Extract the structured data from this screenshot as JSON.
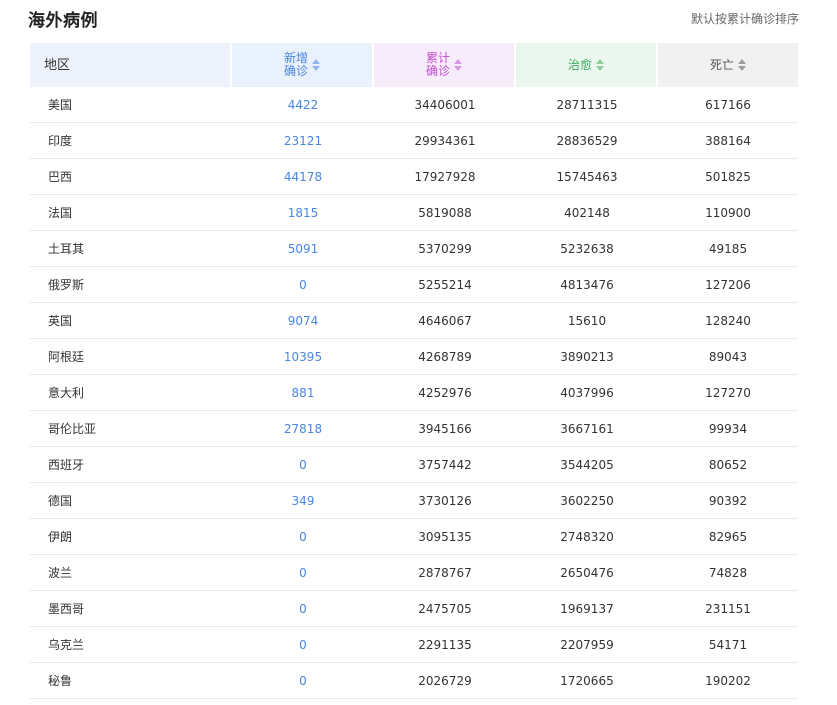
{
  "page": {
    "title": "海外病例",
    "sort_hint": "默认按累计确诊排序"
  },
  "columns": {
    "region": "地区",
    "new": "新增\n确诊",
    "total": "累计\n确诊",
    "cured": "治愈",
    "dead": "死亡"
  },
  "colors": {
    "new": "#4a86e0",
    "total": "#c24fd3",
    "cured": "#3aaa5e",
    "dead": "#555555"
  },
  "rows": [
    {
      "region": "美国",
      "new": "4422",
      "total": "34406001",
      "cured": "28711315",
      "dead": "617166"
    },
    {
      "region": "印度",
      "new": "23121",
      "total": "29934361",
      "cured": "28836529",
      "dead": "388164"
    },
    {
      "region": "巴西",
      "new": "44178",
      "total": "17927928",
      "cured": "15745463",
      "dead": "501825"
    },
    {
      "region": "法国",
      "new": "1815",
      "total": "5819088",
      "cured": "402148",
      "dead": "110900"
    },
    {
      "region": "土耳其",
      "new": "5091",
      "total": "5370299",
      "cured": "5232638",
      "dead": "49185"
    },
    {
      "region": "俄罗斯",
      "new": "0",
      "total": "5255214",
      "cured": "4813476",
      "dead": "127206"
    },
    {
      "region": "英国",
      "new": "9074",
      "total": "4646067",
      "cured": "15610",
      "dead": "128240"
    },
    {
      "region": "阿根廷",
      "new": "10395",
      "total": "4268789",
      "cured": "3890213",
      "dead": "89043"
    },
    {
      "region": "意大利",
      "new": "881",
      "total": "4252976",
      "cured": "4037996",
      "dead": "127270"
    },
    {
      "region": "哥伦比亚",
      "new": "27818",
      "total": "3945166",
      "cured": "3667161",
      "dead": "99934"
    },
    {
      "region": "西班牙",
      "new": "0",
      "total": "3757442",
      "cured": "3544205",
      "dead": "80652"
    },
    {
      "region": "德国",
      "new": "349",
      "total": "3730126",
      "cured": "3602250",
      "dead": "90392"
    },
    {
      "region": "伊朗",
      "new": "0",
      "total": "3095135",
      "cured": "2748320",
      "dead": "82965"
    },
    {
      "region": "波兰",
      "new": "0",
      "total": "2878767",
      "cured": "2650476",
      "dead": "74828"
    },
    {
      "region": "墨西哥",
      "new": "0",
      "total": "2475705",
      "cured": "1969137",
      "dead": "231151"
    },
    {
      "region": "乌克兰",
      "new": "0",
      "total": "2291135",
      "cured": "2207959",
      "dead": "54171"
    },
    {
      "region": "秘鲁",
      "new": "0",
      "total": "2026729",
      "cured": "1720665",
      "dead": "190202"
    }
  ]
}
